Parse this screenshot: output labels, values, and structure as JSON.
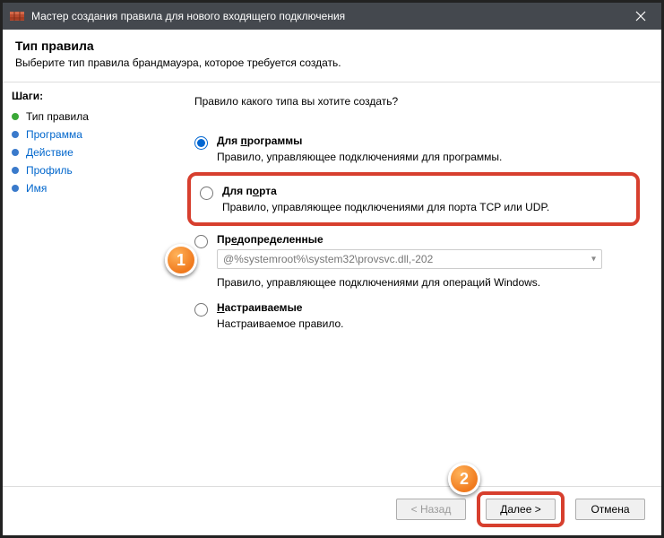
{
  "window": {
    "title": "Мастер создания правила для нового входящего подключения"
  },
  "header": {
    "title": "Тип правила",
    "subtitle": "Выберите тип правила брандмауэра, которое требуется создать."
  },
  "steps": {
    "title": "Шаги:",
    "items": [
      {
        "label": "Тип правила",
        "active": true
      },
      {
        "label": "Программа",
        "active": false
      },
      {
        "label": "Действие",
        "active": false
      },
      {
        "label": "Профиль",
        "active": false
      },
      {
        "label": "Имя",
        "active": false
      }
    ]
  },
  "main": {
    "question": "Правило какого типа вы хотите создать?",
    "options": {
      "program": {
        "label_prefix": "Для ",
        "label_u": "п",
        "label_rest": "рограммы",
        "desc": "Правило, управляющее подключениями для программы."
      },
      "port": {
        "label_prefix": "Для п",
        "label_u": "о",
        "label_rest": "рта",
        "desc": "Правило, управляющее подключениями для порта TCP или UDP."
      },
      "predefined": {
        "label_prefix": "Пр",
        "label_u": "е",
        "label_rest": "допределенные",
        "select_value": "@%systemroot%\\system32\\provsvc.dll,-202",
        "desc": "Правило, управляющее подключениями для операций Windows."
      },
      "custom": {
        "label_u": "Н",
        "label_rest": "астраиваемые",
        "desc": "Настраиваемое правило."
      }
    }
  },
  "callouts": {
    "one": "1",
    "two": "2"
  },
  "footer": {
    "back": "< Назад",
    "next": "Далее >",
    "cancel": "Отмена"
  }
}
